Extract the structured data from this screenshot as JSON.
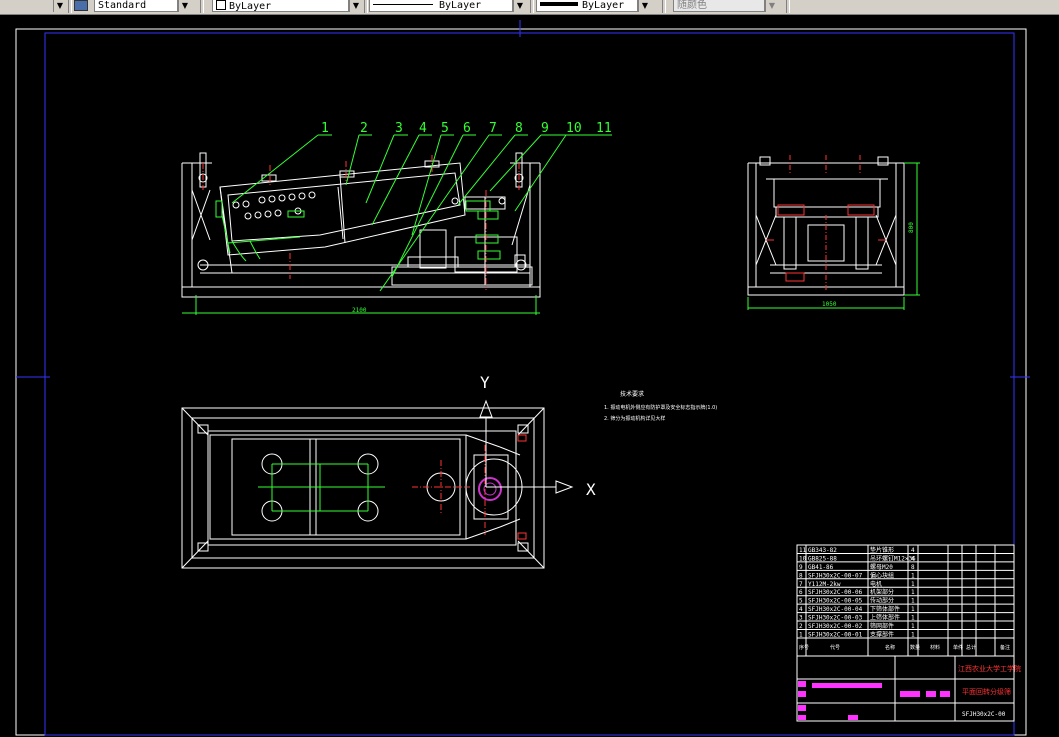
{
  "toolbar": {
    "text_style": "Standard",
    "layer_color": "ByLayer",
    "linetype": "ByLayer",
    "lineweight": "ByLayer",
    "plot_style": "随颜色"
  },
  "drawing": {
    "part_callouts": [
      "1",
      "2",
      "3",
      "4",
      "5",
      "6",
      "7",
      "8",
      "9",
      "10",
      "11"
    ],
    "axis_y": "Y",
    "axis_x": "X",
    "tech_req_title": "技术要求",
    "tech_req_1": "1. 振动电机外侧应有防护罩及安全标志指示牌(1.0)",
    "tech_req_2": "2. 筛分为振动机构详见大样",
    "dim_front_length": "2100",
    "dim_side_width": "1050",
    "dim_side_height": "800"
  },
  "bom": {
    "rows": [
      {
        "no": "11",
        "code": "GB343-82",
        "name": "垫片锥形",
        "qty": "4"
      },
      {
        "no": "10",
        "code": "GB825-88",
        "name": "吊环螺钉M12×36",
        "qty": "4"
      },
      {
        "no": "9",
        "code": "GB41-86",
        "name": "螺母M20",
        "qty": "8"
      },
      {
        "no": "8",
        "code": "SFJH30x2C-00-07",
        "name": "偏心块组",
        "qty": "1"
      },
      {
        "no": "7",
        "code": "Y112M-2kw",
        "name": "电机",
        "qty": "1"
      },
      {
        "no": "6",
        "code": "SFJH30x2C-00-06",
        "name": "机架部分",
        "qty": "1"
      },
      {
        "no": "5",
        "code": "SFJH30x2C-00-05",
        "name": "传动部分",
        "qty": "1"
      },
      {
        "no": "4",
        "code": "SFJH30x2C-00-04",
        "name": "下筛体部件",
        "qty": "1"
      },
      {
        "no": "3",
        "code": "SFJH30x2C-00-03",
        "name": "上筛体部件",
        "qty": "1"
      },
      {
        "no": "2",
        "code": "SFJH30x2C-00-02",
        "name": "筛网部件",
        "qty": "1"
      },
      {
        "no": "1",
        "code": "SFJH30x2C-00-01",
        "name": "支撑部件",
        "qty": "1"
      }
    ],
    "header": [
      "序号",
      "代号",
      "名称",
      "数量",
      "材料",
      "单件",
      "总计",
      "备注"
    ],
    "school": "江西农业大学工学院",
    "title": "平面回转分级筛",
    "drawing_no": "SFJH30x2C-00"
  }
}
